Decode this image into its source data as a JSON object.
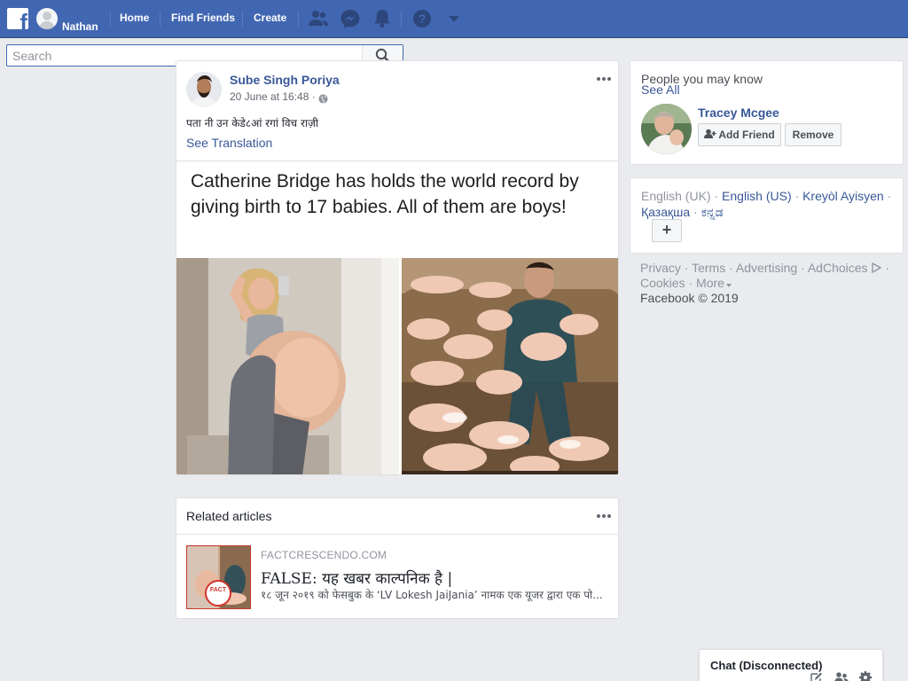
{
  "topbar": {
    "user_name": "Nathan",
    "nav": [
      "Home",
      "Find Friends",
      "Create"
    ],
    "icons": [
      "friends-icon",
      "messenger-icon",
      "notifications-icon",
      "help-icon",
      "account-menu-icon"
    ],
    "brand_color": "#4267b2"
  },
  "search": {
    "placeholder": "Search",
    "value": ""
  },
  "post": {
    "author": "Sube Singh Poriya",
    "time": "20 June at 16:48 ·",
    "text": "पता नी उन केडे८आं रगां विच राज़ी",
    "see_translation": "See Translation",
    "image_caption": "Catherine Bridge has holds the world record by giving birth to 17 babies. All of them are boys!"
  },
  "related": {
    "title": "Related articles",
    "domain": "FACTCRESCENDO.COM",
    "article_title": "FALSE: यह खबर काल्पनिक है |",
    "article_desc": "१८ जून २०१९ को फेसबुक के ‘LV Lokesh JaiJania’ नामक एक यूजर द्वारा एक पो...",
    "thumb_badge": "FACT"
  },
  "pymk": {
    "title": "People you may know",
    "see_all": "See All",
    "name": "Tracey Mcgee",
    "add_friend": "Add Friend",
    "remove": "Remove"
  },
  "languages": {
    "current": "English (UK)",
    "links": [
      "English (US)",
      "Kreyòl Ayisyen",
      "Қазақша",
      "ಕನ್ನಡ"
    ],
    "add": "+"
  },
  "footer": {
    "links": [
      "Privacy",
      "Terms",
      "Advertising",
      "AdChoices",
      "Cookies",
      "More"
    ],
    "copyright": "Facebook © 2019"
  },
  "chat": {
    "title": "Chat (Disconnected)"
  }
}
